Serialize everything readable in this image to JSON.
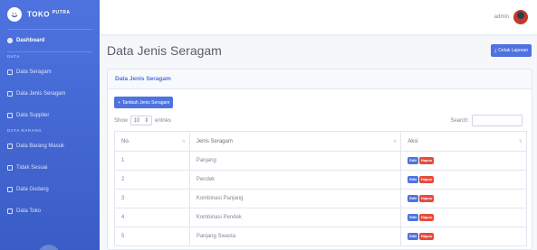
{
  "brand": {
    "name": "TOKO",
    "suffix": "PUTRA"
  },
  "sidebar": {
    "dashboard": "Dashboard",
    "section_master": "DATA",
    "items_master": [
      {
        "label": "Data Seragam"
      },
      {
        "label": "Data Jenis Seragam"
      },
      {
        "label": "Data Supplier"
      }
    ],
    "section_barang": "DATA BARANG",
    "items_barang": [
      {
        "label": "Data Barang Masuk"
      },
      {
        "label": "Tidak Sesuai"
      },
      {
        "label": "Data Gudang"
      },
      {
        "label": "Data Toko"
      }
    ]
  },
  "topbar": {
    "user_name": "admin"
  },
  "page": {
    "title": "Data Jenis Seragam",
    "print_label": "Cetak Laporan"
  },
  "card": {
    "title": "Data Jenis Seragam",
    "add_label": "Tambah Jenis Seragam",
    "show_label": "Show",
    "length_value": "10",
    "entries_label": "entries",
    "search_label": "Search:"
  },
  "table": {
    "headers": [
      "No.",
      "Jenis Seragam",
      "Aksi"
    ],
    "edit_label": "Edit",
    "delete_label": "Hapus",
    "rows": [
      {
        "no": "1",
        "jenis": "Panjang"
      },
      {
        "no": "2",
        "jenis": "Pendek"
      },
      {
        "no": "3",
        "jenis": "Kombinasi Panjang"
      },
      {
        "no": "4",
        "jenis": "Kombinasi Pendek"
      },
      {
        "no": "5",
        "jenis": "Panjang Swasta"
      }
    ]
  },
  "colors": {
    "primary": "#4e73df",
    "danger": "#e74a3b"
  }
}
